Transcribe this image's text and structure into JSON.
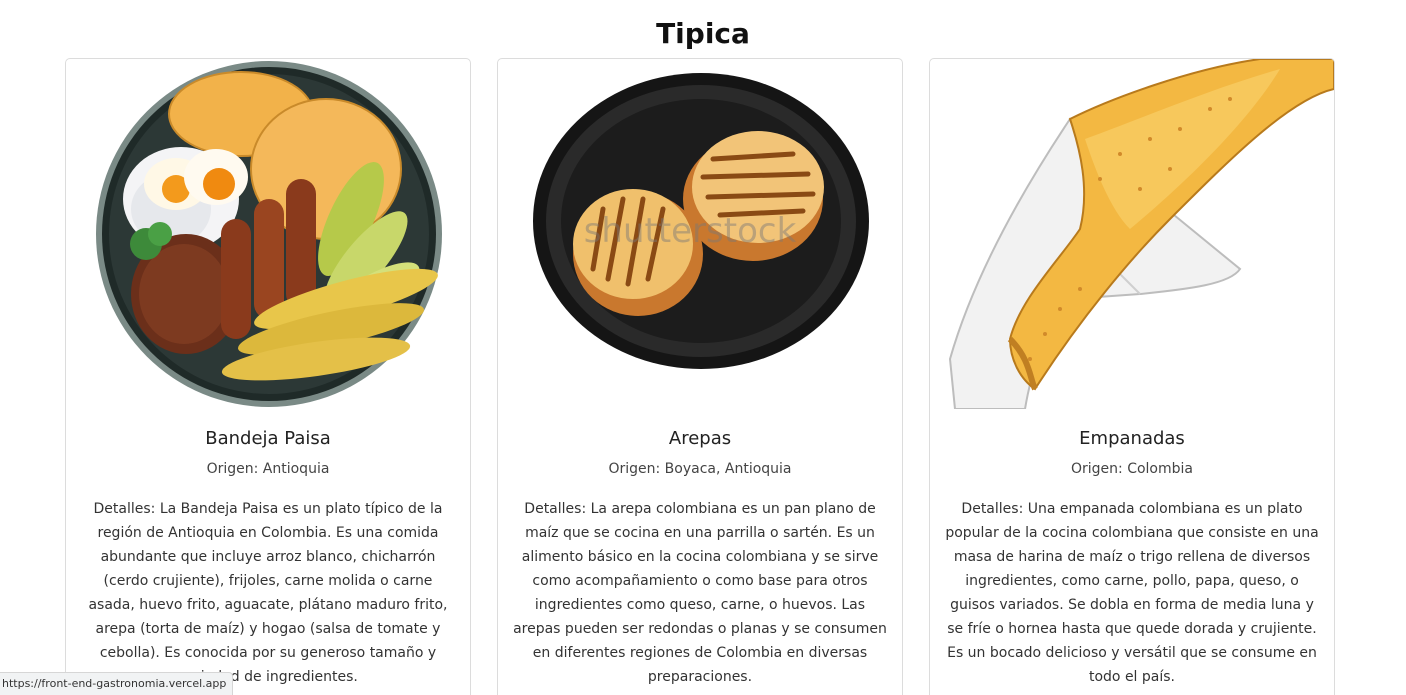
{
  "section": {
    "title": "Tipica"
  },
  "cards": [
    {
      "image_icon": "bandeja-paisa-illustration",
      "title": "Bandeja Paisa",
      "origin": "Origen: Antioquia",
      "details": "Detalles: La Bandeja Paisa es un plato típico de la región de Antioquia en Colombia. Es una comida abundante que incluye arroz blanco, chicharrón (cerdo crujiente), frijoles, carne molida o carne asada, huevo frito, aguacate, plátano maduro frito, arepa (torta de maíz) y hogao (salsa de tomate y cebolla). Es conocida por su generoso tamaño y variedad de ingredientes."
    },
    {
      "image_icon": "arepas-illustration",
      "image_watermark": "shutterstock",
      "title": "Arepas",
      "origin": "Origen: Boyaca, Antioquia",
      "details": "Detalles: La arepa colombiana es un pan plano de maíz que se cocina en una parrilla o sartén. Es un alimento básico en la cocina colombiana y se sirve como acompañamiento o como base para otros ingredientes como queso, carne, o huevos. Las arepas pueden ser redondas o planas y se consumen en diferentes regiones de Colombia en diversas preparaciones."
    },
    {
      "image_icon": "empanadas-illustration",
      "title": "Empanadas",
      "origin": "Origen: Colombia",
      "details": "Detalles: Una empanada colombiana es un plato popular de la cocina colombiana que consiste en una masa de harina de maíz o trigo rellena de diversos ingredientes, como carne, pollo, papa, queso, o guisos variados. Se dobla en forma de media luna y se fríe o hornea hasta que quede dorada y crujiente. Es un bocado delicioso y versátil que se consume en todo el país."
    }
  ],
  "status_bar": {
    "url": "https://front-end-gastronomia.vercel.app"
  }
}
